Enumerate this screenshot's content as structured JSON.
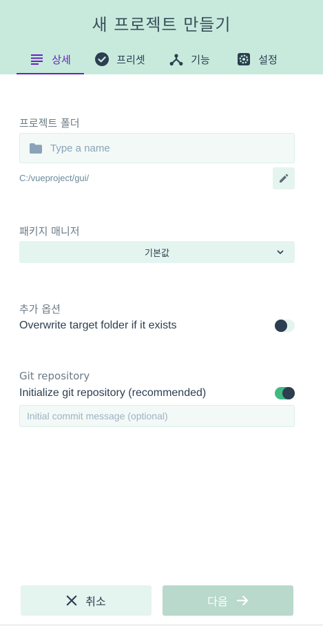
{
  "title": "새 프로젝트 만들기",
  "tabs": [
    {
      "label": "상세",
      "icon": "details-list-icon",
      "active": true
    },
    {
      "label": "프리셋",
      "icon": "check-circle-icon",
      "active": false
    },
    {
      "label": "기능",
      "icon": "fork-icon",
      "active": false
    },
    {
      "label": "설정",
      "icon": "gear-icon",
      "active": false
    }
  ],
  "project_folder": {
    "label": "프로젝트 폴더",
    "placeholder": "Type a name",
    "value": "",
    "path": "C:/vueproject/gui/"
  },
  "package_manager": {
    "label": "패키지 매니저",
    "selected": "기본값"
  },
  "additional_options": {
    "label": "추가 옵션",
    "overwrite_text": "Overwrite target folder if it exists",
    "overwrite_enabled": false
  },
  "git": {
    "label": "Git repository",
    "init_text": "Initialize git repository (recommended)",
    "init_enabled": true,
    "commit_placeholder": "Initial commit message (optional)"
  },
  "buttons": {
    "cancel": "취소",
    "next": "다음"
  },
  "colors": {
    "header_bg": "#c7eadd",
    "accent_purple": "#6a1fbf",
    "accent_green": "#42b983",
    "text_dark": "#2c3e50"
  }
}
